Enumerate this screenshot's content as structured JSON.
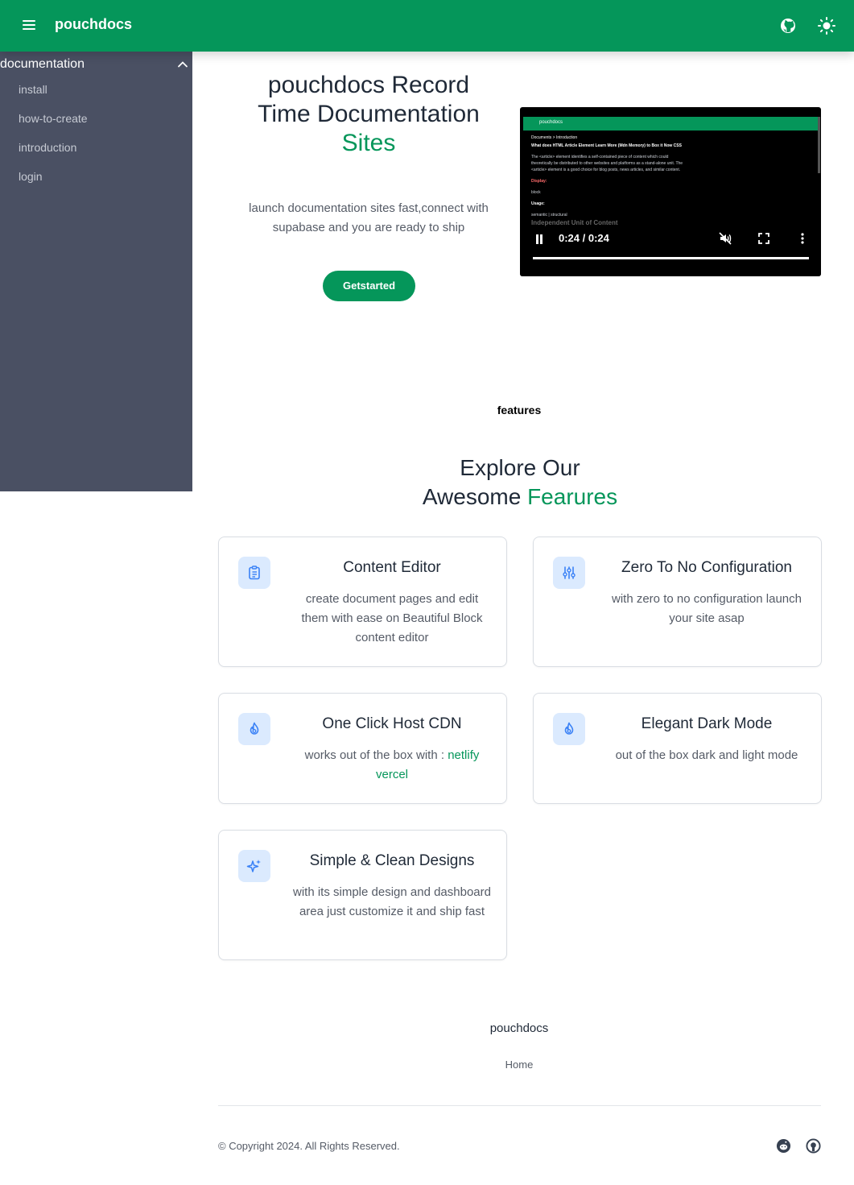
{
  "topbar": {
    "brand": "pouchdocs",
    "icons": [
      "menu-icon",
      "github-icon",
      "sun-icon"
    ]
  },
  "sidebar": {
    "section": "documentation",
    "items": [
      {
        "label": "install"
      },
      {
        "label": "how-to-create"
      },
      {
        "label": "introduction"
      },
      {
        "label": "login"
      }
    ]
  },
  "hero": {
    "title": "pouchdocs Record Time Documentation",
    "title_accent": "Sites",
    "subtitle": "launch documentation sites fast,connect with supabase and you are ready to ship",
    "cta": "Getstarted"
  },
  "video": {
    "app_title": "pouchdocs",
    "breadcrumb": "Documents  >  Introduction",
    "heading": "What does HTML Article Element Learn More (Mdn Memory) to Box it Now CSS",
    "paragraph": "The <article> element identifies a self-contained piece of content which could theoretically be distributed to other websites and platforms as a stand-alone unit. The <article> element is a good choice for blog posts, news articles, and similar content.",
    "labels": [
      "Display:",
      "block",
      "Usage:",
      "semantic | structural"
    ],
    "overlay_heading": "Independent Unit of Content",
    "time": "0:24 / 0:24",
    "progress_percent": 100
  },
  "features": {
    "eyebrow": "features",
    "heading_line1": "Explore Our",
    "heading_line2": "Awesome",
    "heading_accent": "Fearures",
    "cards": [
      {
        "icon": "clipboard-icon",
        "title": "Content Editor",
        "desc": "create document pages and edit them with ease on Beautiful Block content editor"
      },
      {
        "icon": "sliders-icon",
        "title": "Zero To No Configuration",
        "desc": "with zero to no configuration launch your site asap"
      },
      {
        "icon": "flame-icon",
        "title": "One Click Host CDN",
        "desc": "works out of the box with : ",
        "link1": "netlify",
        "link2": "vercel"
      },
      {
        "icon": "flame-icon",
        "title": "Elegant Dark Mode",
        "desc": "out of the box dark and light mode"
      },
      {
        "icon": "sparkles-icon",
        "title": "Simple & Clean Designs",
        "desc": "with its simple design and dashboard area just customize it and ship fast"
      }
    ]
  },
  "footer": {
    "brand": "pouchdocs",
    "home": "Home",
    "copyright": "© Copyright 2024. All Rights Reserved.",
    "social_icons": [
      "reddit-icon",
      "github-icon"
    ]
  },
  "colors": {
    "brand_green": "#05965a",
    "sidebar_bg": "#4a5063",
    "icon_bg": "#dbeafe",
    "icon_blue": "#3b82f6"
  }
}
